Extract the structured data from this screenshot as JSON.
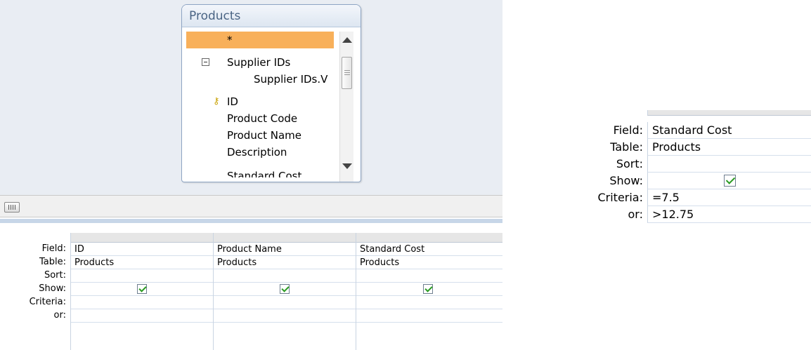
{
  "field_list": {
    "title": "Products",
    "items": [
      "*",
      "Supplier IDs",
      "Supplier IDs.V",
      "ID",
      "Product Code",
      "Product Name",
      "Description",
      "Standard Cost"
    ]
  },
  "grid": {
    "row_labels": [
      "Field:",
      "Table:",
      "Sort:",
      "Show:",
      "Criteria:",
      "or:"
    ],
    "columns": [
      {
        "field": "ID",
        "table": "Products",
        "sort": "",
        "show": true,
        "criteria": "",
        "or": ""
      },
      {
        "field": "Product Name",
        "table": "Products",
        "sort": "",
        "show": true,
        "criteria": "",
        "or": ""
      },
      {
        "field": "Standard Cost",
        "table": "Products",
        "sort": "",
        "show": true,
        "criteria": "",
        "or": ""
      }
    ]
  },
  "detail": {
    "row_labels": [
      "Field:",
      "Table:",
      "Sort:",
      "Show:",
      "Criteria:",
      "or:"
    ],
    "field": "Standard Cost",
    "table": "Products",
    "sort": "",
    "show": true,
    "criteria": "=7.5",
    "or": ">12.75"
  },
  "colors": {
    "selected_item": "#f8b05a",
    "pane_background": "#e9edf3",
    "checkmark": "#2a9b22",
    "grid_line": "#c9d4e2"
  }
}
